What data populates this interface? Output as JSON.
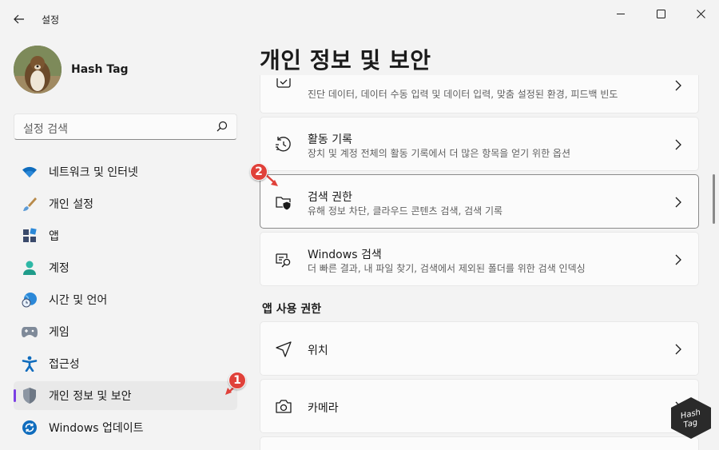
{
  "window": {
    "title": "설정",
    "controls": [
      "minimize-icon",
      "maximize-icon",
      "close-icon"
    ]
  },
  "profile": {
    "name": "Hash Tag"
  },
  "search": {
    "placeholder": "설정 검색"
  },
  "nav": {
    "items": [
      {
        "label": "네트워크 및 인터넷",
        "icon": "wifi-icon",
        "active": false
      },
      {
        "label": "개인 설정",
        "icon": "brush-icon",
        "active": false
      },
      {
        "label": "앱",
        "icon": "apps-icon",
        "active": false
      },
      {
        "label": "계정",
        "icon": "person-icon",
        "active": false
      },
      {
        "label": "시간 및 언어",
        "icon": "globe-clock-icon",
        "active": false
      },
      {
        "label": "게임",
        "icon": "gamepad-icon",
        "active": false
      },
      {
        "label": "접근성",
        "icon": "accessibility-icon",
        "active": false
      },
      {
        "label": "개인 정보 및 보안",
        "icon": "shield-icon",
        "active": true
      },
      {
        "label": "Windows 업데이트",
        "icon": "update-icon",
        "active": false
      }
    ]
  },
  "main": {
    "title": "개인 정보 및 보안",
    "cards": [
      {
        "title": "",
        "subtitle": "진단 데이터, 데이터 수동 입력 및 데이터 입력, 맞춤 설정된 환경, 피드백 빈도",
        "icon": "diagnostics-icon"
      },
      {
        "title": "활동 기록",
        "subtitle": "장치 및 계정 전체의 활동 기록에서 더 많은 항목을 얻기 위한 옵션",
        "icon": "history-icon"
      },
      {
        "title": "검색 권한",
        "subtitle": "유해 정보 차단, 클라우드 콘텐츠 검색, 검색 기록",
        "icon": "search-permissions-icon"
      },
      {
        "title": "Windows 검색",
        "subtitle": "더 빠른 결과, 내 파일 찾기, 검색에서 제외된 폴더를 위한 검색 인덱싱",
        "icon": "windows-search-icon"
      }
    ],
    "section_label": "앱 사용 권한",
    "permission_items": [
      {
        "title": "위치",
        "icon": "location-icon"
      },
      {
        "title": "카메라",
        "icon": "camera-icon"
      }
    ]
  },
  "annotations": {
    "badge1": "1",
    "badge2": "2",
    "badge_color": "#e0413a"
  },
  "logo": {
    "text_line1": "Hash",
    "text_line2": "Tag"
  }
}
